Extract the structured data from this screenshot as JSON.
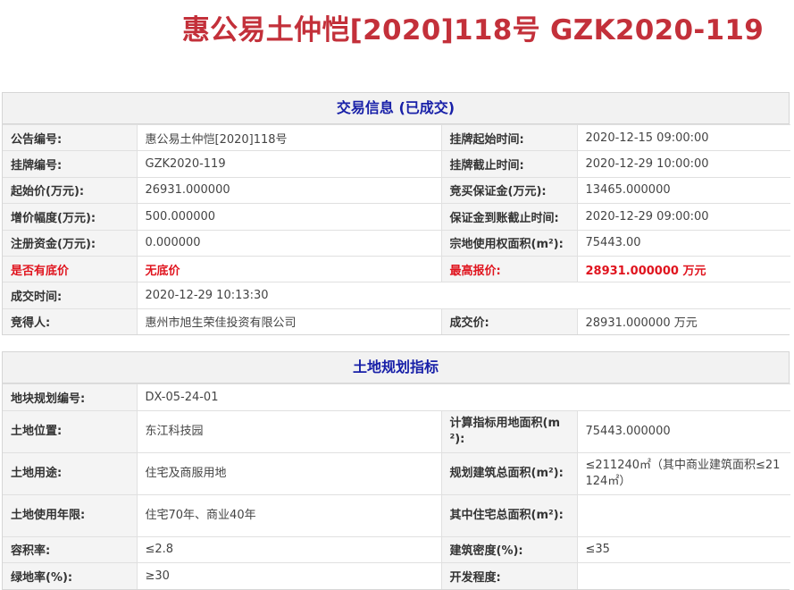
{
  "page": {
    "title": "惠公易土仲恺[2020]118号 GZK2020-119"
  },
  "trade": {
    "heading": "交易信息 (已成交)",
    "rows": [
      {
        "l1": "公告编号:",
        "v1": "惠公易土仲恺[2020]118号",
        "l2": "挂牌起始时间:",
        "v2": "2020-12-15 09:00:00"
      },
      {
        "l1": "挂牌编号:",
        "v1": "GZK2020-119",
        "l2": "挂牌截止时间:",
        "v2": "2020-12-29 10:00:00"
      },
      {
        "l1": "起始价(万元):",
        "v1": "26931.000000",
        "l2": "竞买保证金(万元):",
        "v2": "13465.000000"
      },
      {
        "l1": "增价幅度(万元):",
        "v1": "500.000000",
        "l2": "保证金到账截止时间:",
        "v2": "2020-12-29 09:00:00"
      },
      {
        "l1": "注册资金(万元):",
        "v1": "0.000000",
        "l2": "宗地使用权面积(m²):",
        "v2": "75443.00"
      },
      {
        "l1": "是否有底价",
        "v1": "无底价",
        "l2": "最高报价:",
        "v2": "28931.000000 万元"
      },
      {
        "l1": "成交时间:",
        "v1": "2020-12-29 10:13:30",
        "l2": "",
        "v2": ""
      },
      {
        "l1": "竞得人:",
        "v1": "惠州市旭生荣佳投资有限公司",
        "l2": "成交价:",
        "v2": "28931.000000 万元"
      }
    ]
  },
  "plan": {
    "heading": "土地规划指标",
    "rows": [
      {
        "l1": "地块规划编号:",
        "v1": "DX-05-24-01",
        "l2": "",
        "v2": ""
      },
      {
        "l1": "土地位置:",
        "v1": "东江科技园",
        "l2": "计算指标用地面积(m²):",
        "v2": "75443.000000"
      },
      {
        "l1": "土地用途:",
        "v1": "住宅及商服用地",
        "l2": "规划建筑总面积(m²):",
        "v2": "≤211240㎡（其中商业建筑面积≤21124㎡）"
      },
      {
        "l1": "土地使用年限:",
        "v1": "住宅70年、商业40年",
        "l2": "其中住宅总面积(m²):",
        "v2": ""
      },
      {
        "l1": "容积率:",
        "v1": "≤2.8",
        "l2": "建筑密度(%):",
        "v2": "≤35"
      },
      {
        "l1": "绿地率(%):",
        "v1": "≥30",
        "l2": "开发程度:",
        "v2": ""
      }
    ]
  },
  "colors": {
    "title_red": "#c3303a",
    "heading_blue": "#1820a8",
    "alert_red": "#e0141e"
  }
}
